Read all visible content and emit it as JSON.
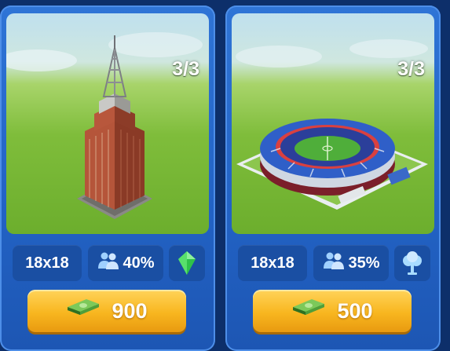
{
  "cards": [
    {
      "building": "skyscraper",
      "count": "3/3",
      "size": "18x18",
      "population_bonus": "40%",
      "perk_icon": "green-crystal-icon",
      "price": "900",
      "price_icon": "cash-stack-icon"
    },
    {
      "building": "stadium",
      "count": "3/3",
      "size": "18x18",
      "population_bonus": "35%",
      "perk_icon": "tree-icon",
      "price": "500",
      "price_icon": "cash-stack-icon"
    }
  ],
  "colors": {
    "card_blue": "#2262c4",
    "stat_blue": "#1a4fa3",
    "button_gold": "#f8b61f",
    "grass_green": "#7fbd3b",
    "crystal_green": "#2fc24a"
  }
}
